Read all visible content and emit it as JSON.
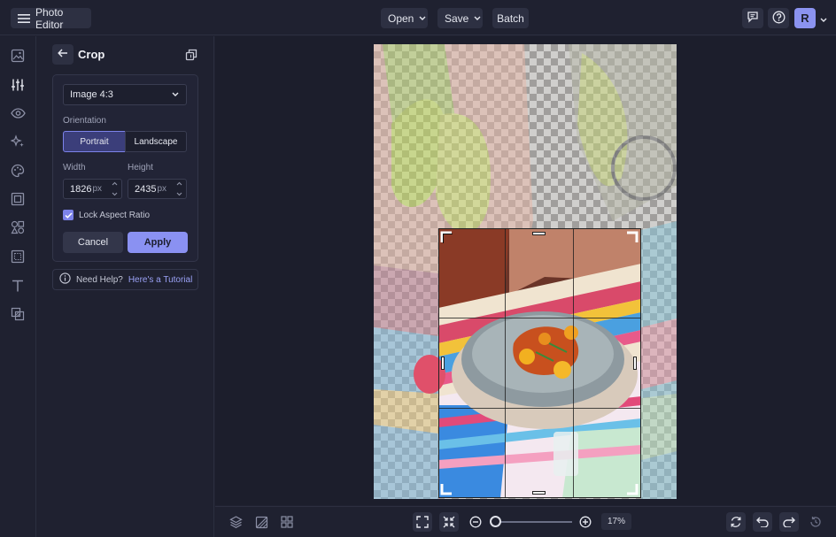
{
  "app": {
    "title": "Photo Editor",
    "accent": "#7c83ea",
    "avatar_initial": "R"
  },
  "topbar": {
    "open_label": "Open",
    "save_label": "Save",
    "batch_label": "Batch"
  },
  "rail": {
    "items": [
      "image-icon",
      "sliders-icon",
      "eye-icon",
      "sparkle-icon",
      "palette-icon",
      "frame-icon",
      "shapes-icon",
      "texture-icon",
      "text-icon",
      "overlay-icon"
    ],
    "active": "sliders-icon"
  },
  "panel": {
    "title": "Crop",
    "preset": "Image 4:3",
    "orientation_label": "Orientation",
    "orientation_options": [
      "Portrait",
      "Landscape"
    ],
    "orientation_selected": "Portrait",
    "width_label": "Width",
    "height_label": "Height",
    "width_value": "1826",
    "height_value": "2435",
    "unit": "px",
    "lock_label": "Lock Aspect Ratio",
    "lock_checked": true,
    "cancel_label": "Cancel",
    "apply_label": "Apply",
    "help_text": "Need Help?",
    "help_link": "Here's a Tutorial"
  },
  "bottombar": {
    "zoom_value": "17%"
  }
}
